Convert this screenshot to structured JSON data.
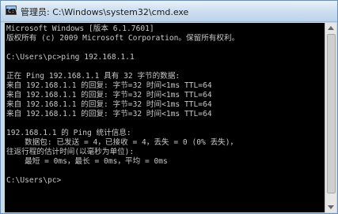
{
  "window": {
    "title": "管理员: C:\\Windows\\system32\\cmd.exe",
    "icon": "cmd-icon"
  },
  "console": {
    "lines": [
      "Microsoft Windows [版本 6.1.7601]",
      "版权所有 (c) 2009 Microsoft Corporation。保留所有权利。",
      "",
      "C:\\Users\\pc>ping 192.168.1.1",
      "",
      "正在 Ping 192.168.1.1 具有 32 字节的数据:",
      "来自 192.168.1.1 的回复: 字节=32 时间<1ms TTL=64",
      "来自 192.168.1.1 的回复: 字节=32 时间<1ms TTL=64",
      "来自 192.168.1.1 的回复: 字节=32 时间<1ms TTL=64",
      "来自 192.168.1.1 的回复: 字节=32 时间<1ms TTL=64",
      "",
      "192.168.1.1 的 Ping 统计信息:",
      "    数据包: 已发送 = 4，已接收 = 4，丢失 = 0 (0% 丢失)，",
      "往返行程的估计时间(以毫秒为单位):",
      "    最短 = 0ms，最长 = 0ms，平均 = 0ms",
      "",
      "C:\\Users\\pc>"
    ]
  }
}
